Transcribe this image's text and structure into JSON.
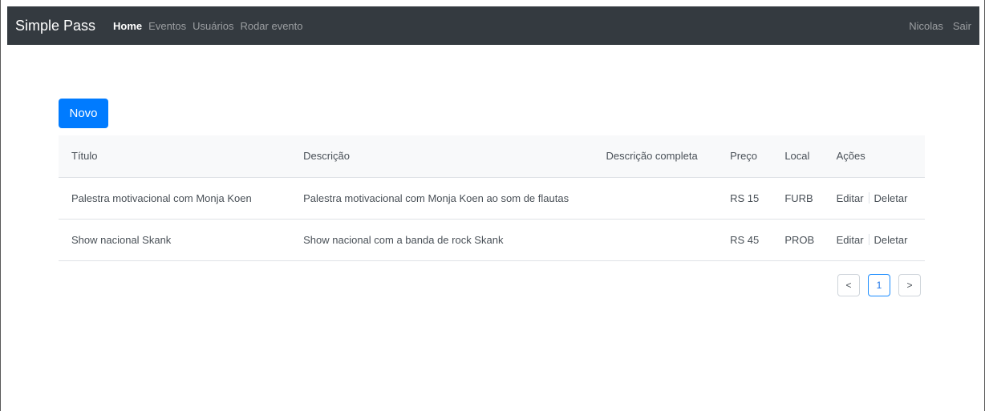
{
  "navbar": {
    "brand": "Simple Pass",
    "links": [
      {
        "label": "Home",
        "active": true
      },
      {
        "label": "Eventos",
        "active": false
      },
      {
        "label": "Usuários",
        "active": false
      },
      {
        "label": "Rodar evento",
        "active": false
      }
    ],
    "user": "Nicolas",
    "logout": "Sair",
    "background_color": "#343a40"
  },
  "toolbar": {
    "new_label": "Novo",
    "button_color": "#007bff"
  },
  "table": {
    "headers": [
      "Título",
      "Descrição",
      "Descrição completa",
      "Preço",
      "Local",
      "Ações"
    ],
    "rows": [
      {
        "titulo": "Palestra motivacional com Monja Koen",
        "descricao": "Palestra motivacional com Monja Koen ao som de flautas",
        "descricao_completa": "",
        "preco": "RS 15",
        "local": "FURB",
        "edit": "Editar",
        "delete": "Deletar"
      },
      {
        "titulo": "Show nacional Skank",
        "descricao": "Show nacional com a banda de rock Skank",
        "descricao_completa": "",
        "preco": "RS 45",
        "local": "PROB",
        "edit": "Editar",
        "delete": "Deletar"
      }
    ]
  },
  "pagination": {
    "prev": "<",
    "current": "1",
    "next": ">"
  }
}
